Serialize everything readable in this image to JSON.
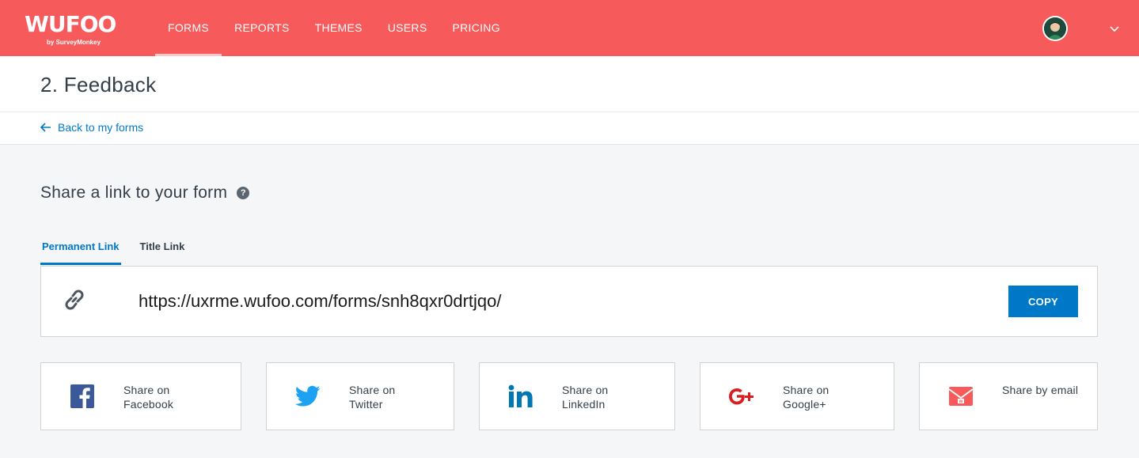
{
  "header": {
    "logo_text": "WUFOO",
    "logo_subtext": "by SurveyMonkey",
    "nav": [
      {
        "label": "FORMS",
        "active": true
      },
      {
        "label": "REPORTS",
        "active": false
      },
      {
        "label": "THEMES",
        "active": false
      },
      {
        "label": "USERS",
        "active": false
      },
      {
        "label": "PRICING",
        "active": false
      }
    ],
    "brand_color": "#f65a5a"
  },
  "page": {
    "title": "2. Feedback",
    "back_link": "Back to my forms"
  },
  "share": {
    "heading": "Share a link to your form",
    "help_glyph": "?",
    "tabs": [
      {
        "label": "Permanent Link",
        "active": true
      },
      {
        "label": "Title Link",
        "active": false
      }
    ],
    "url": "https://uxrme.wufoo.com/forms/snh8qxr0drtjqo/",
    "copy_label": "COPY",
    "accent_color": "#0078c8",
    "options": [
      {
        "label": "Share on Facebook",
        "icon": "facebook-icon"
      },
      {
        "label": "Share on Twitter",
        "icon": "twitter-icon"
      },
      {
        "label": "Share on LinkedIn",
        "icon": "linkedin-icon"
      },
      {
        "label": "Share on Google+",
        "icon": "google-plus-icon"
      },
      {
        "label": "Share by email",
        "icon": "email-icon"
      }
    ]
  }
}
